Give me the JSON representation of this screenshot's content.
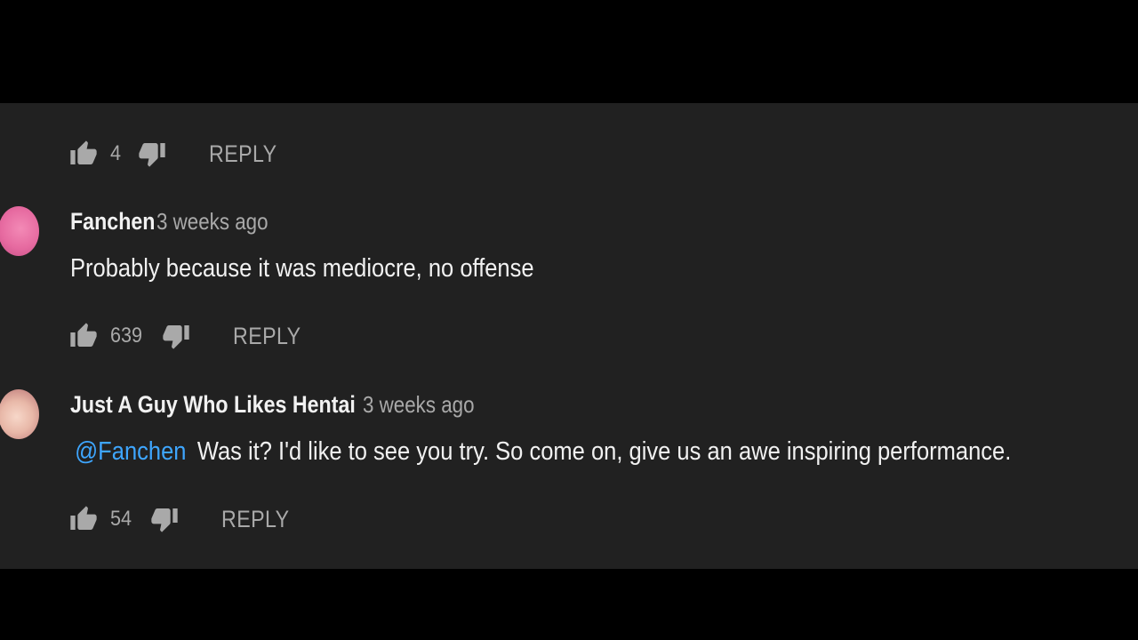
{
  "top_comment": {
    "likes": "4",
    "reply_label": "REPLY"
  },
  "comments": [
    {
      "author": "Fanchen",
      "time": "3 weeks ago",
      "text": "Probably because it was mediocre, no offense",
      "likes": "639",
      "reply_label": "REPLY"
    },
    {
      "author": "Just A Guy Who Likes Hentai",
      "time": "3 weeks ago",
      "mention": "@Fanchen",
      "text": "Was it? I'd like to see you try. So come on, give us an awe inspiring performance.",
      "likes": "54",
      "reply_label": "REPLY"
    }
  ],
  "icons": {
    "like": "thumbs-up-icon",
    "dislike": "thumbs-down-icon"
  },
  "colors": {
    "background": "#212121",
    "letterbox": "#000000",
    "primary_text": "#f1f1f1",
    "secondary_text": "#a9a9a9",
    "mention": "#3ea6ff"
  }
}
